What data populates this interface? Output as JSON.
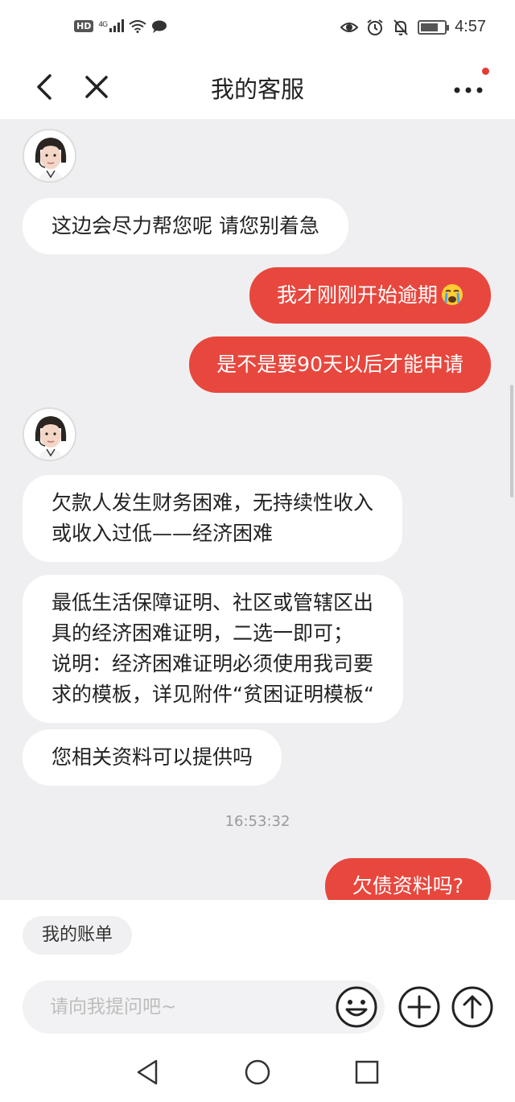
{
  "status_bar": {
    "left_badge": "HD",
    "network": "4G",
    "time": "4:57",
    "battery_level": 0.75
  },
  "header": {
    "title": "我的客服"
  },
  "messages": {
    "m1": "这边会尽力帮您呢 请您别着急",
    "m2": "我才刚刚开始逾期",
    "m3": "是不是要90天以后才能申请",
    "m4_line1": "欠款人发生财务困难，无持续性收入",
    "m4_line2": "或收入过低——经济困难",
    "m5_line1": "最低生活保障证明、社区或管辖区出",
    "m5_line2": "具的经济困难证明，二选一即可；",
    "m5_line3": "说明：经济困难证明必须使用我司要",
    "m5_line4": "求的模板，详见附件“贫困证明模板“",
    "m6": "您相关资料可以提供吗",
    "timestamp": "16:53:32",
    "m7": "欠债资料吗?"
  },
  "bottom": {
    "chip_label": "我的账单",
    "input_placeholder": "请向我提问吧~"
  },
  "colors": {
    "accent": "#e8473e",
    "background": "#efeff1"
  },
  "icons": [
    "back-icon",
    "close-icon",
    "more-icon",
    "emoji-icon",
    "plus-icon",
    "upload-icon",
    "nav-back-icon",
    "nav-home-icon",
    "nav-recent-icon"
  ]
}
